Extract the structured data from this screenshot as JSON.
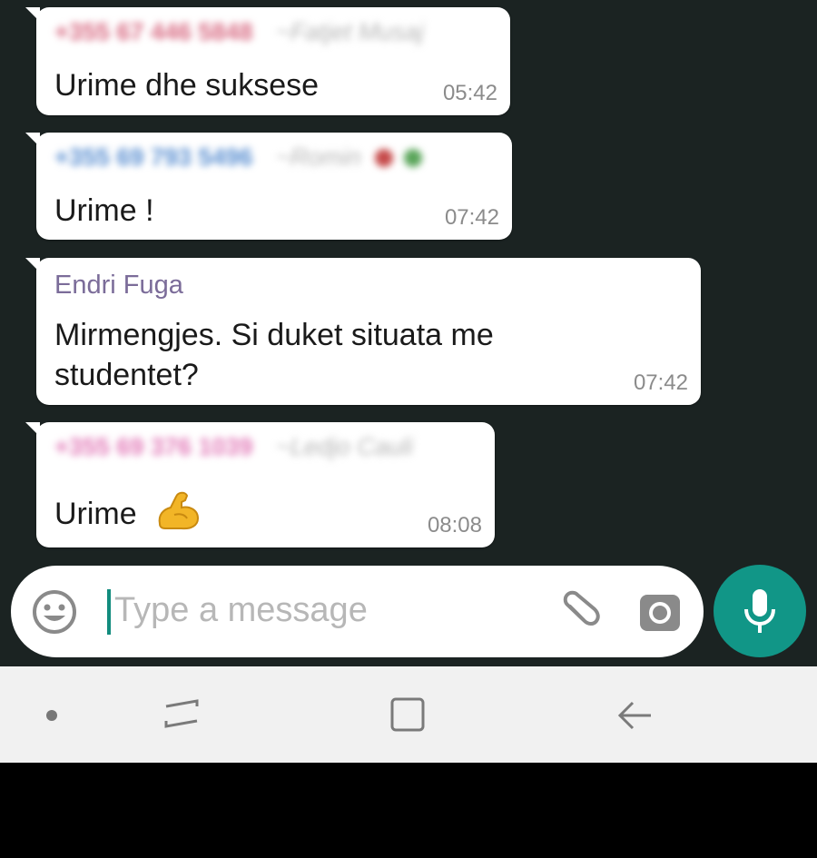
{
  "messages": [
    {
      "sender_number": "+355 67 446 5848",
      "sender_alias": "~Fatjet Musaj",
      "text": "Urime dhe suksese",
      "time": "05:42",
      "sender_color": "#d86a82"
    },
    {
      "sender_number": "+355 69 793 5496",
      "sender_alias": "~Romin",
      "text": "Urime !",
      "time": "07:42",
      "sender_color": "#5a8fd1"
    },
    {
      "sender_name": "Endri Fuga",
      "text": "Mirmengjes. Si duket situata me studentet?",
      "time": "07:42",
      "sender_color": "#7b6c99"
    },
    {
      "sender_number": "+355 69 376 1039",
      "sender_alias": "~Ledjo Cauli",
      "text": "Urime",
      "time": "08:08",
      "emoji": "flexed-biceps",
      "sender_color": "#e27ab8"
    }
  ],
  "composer": {
    "placeholder": "Type a message",
    "icons": [
      "emoji-icon",
      "paperclip-icon",
      "camera-icon",
      "mic-icon"
    ],
    "accent": "#119687"
  },
  "navbar": {
    "icons": [
      "dot-icon",
      "recent-apps-icon",
      "home-icon",
      "back-icon"
    ]
  }
}
